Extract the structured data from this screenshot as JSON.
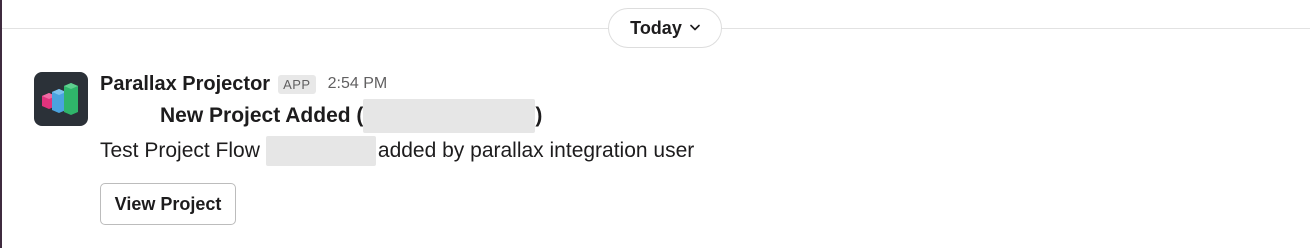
{
  "date_divider": {
    "label": "Today",
    "icon": "chevron-down-icon"
  },
  "message": {
    "app_name": "Parallax Projector",
    "badge": "APP",
    "time": "2:54 PM",
    "avatar_icon": "parallax-logo-icon",
    "headline_prefix": "New Project Added (",
    "headline_suffix": ")",
    "body_prefix": "Test Project Flow",
    "body_suffix": "added by parallax integration user",
    "button_label": "View Project"
  },
  "colors": {
    "logo_pink": "#e0337d",
    "logo_blue": "#4aa3df",
    "logo_green": "#2fb56a",
    "avatar_bg": "#2b3138",
    "sidebar_edge": "#3f2b3f"
  }
}
